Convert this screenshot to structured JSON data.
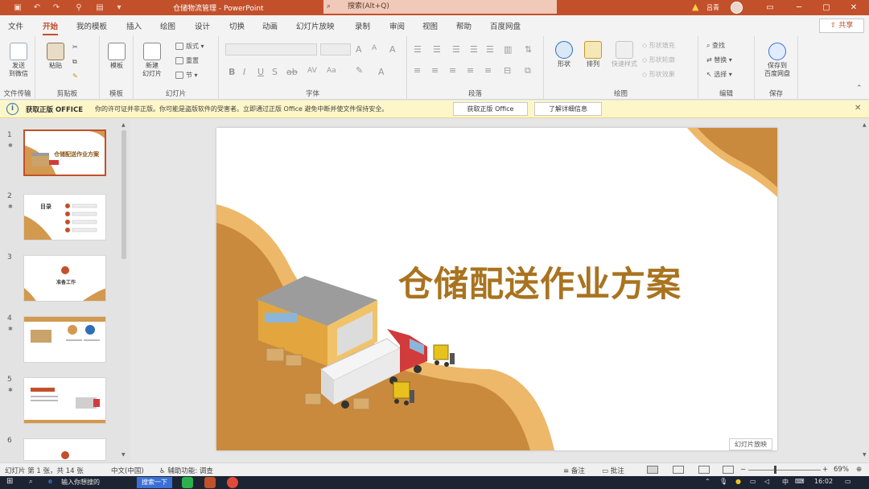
{
  "titlebar": {
    "doc_title": "仓储物流管理",
    "app_name": "PowerPoint",
    "search_placeholder": "搜索(Alt+Q)",
    "user": "吕青",
    "accent": "#c2502a"
  },
  "tabs": [
    {
      "label": "文件"
    },
    {
      "label": "开始"
    },
    {
      "label": "我的模板"
    },
    {
      "label": "插入"
    },
    {
      "label": "绘图"
    },
    {
      "label": "设计"
    },
    {
      "label": "切换"
    },
    {
      "label": "动画"
    },
    {
      "label": "幻灯片放映"
    },
    {
      "label": "录制"
    },
    {
      "label": "审阅"
    },
    {
      "label": "视图"
    },
    {
      "label": "帮助"
    },
    {
      "label": "百度网盘"
    }
  ],
  "share_label": "共享",
  "ribbon": {
    "send": "发送\n到微信",
    "file_transfer": "文件传输",
    "paste": "粘贴",
    "clipboard": "剪贴板",
    "template": "模板",
    "template_group": "模板",
    "new_slide": "新建\n幻灯片",
    "layout": "版式",
    "reset": "重置",
    "section": "节",
    "slides_group": "幻灯片",
    "font_group": "字体",
    "paragraph_group": "段落",
    "shapes": "形状",
    "arrange": "排列",
    "quick_styles": "快速样式",
    "shape_fill": "形状填充",
    "shape_outline": "形状轮廓",
    "shape_effects": "形状效果",
    "drawing_group": "绘图",
    "find": "查找",
    "replace": "替换",
    "select": "选择",
    "editing_group": "编辑",
    "save_to_cloud": "保存到\n百度网盘",
    "save_group": "保存"
  },
  "notification": {
    "title": "获取正版 OFFICE",
    "message": "你的许可证并非正版。你可能是盗版软件的受害者。立即通过正版 Office 避免中断并使文件保持安全。",
    "btn_get": "获取正版 Office",
    "btn_more": "了解详细信息"
  },
  "thumbnails": [
    {
      "num": "1",
      "title": "仓储配送作业方案"
    },
    {
      "num": "2",
      "title": "目录"
    },
    {
      "num": "3",
      "title": "准备工作"
    },
    {
      "num": "4",
      "title": ""
    },
    {
      "num": "5",
      "title": ""
    },
    {
      "num": "6",
      "title": ""
    }
  ],
  "slide": {
    "title": "仓储配送作业方案",
    "accent_dark": "#c98a3e",
    "accent_light": "#edb869"
  },
  "slideshow_label": "幻灯片放映",
  "status": {
    "slide_info": "幻灯片 第 1 张，共 14 张",
    "language": "中文(中国)",
    "accessibility": "辅助功能: 调查",
    "notes": "备注",
    "comments": "批注",
    "zoom": "69%"
  },
  "taskbar": {
    "search_text": "输入你想搜的",
    "search_button": "搜索一下",
    "ime": "中",
    "time": "16:02"
  }
}
